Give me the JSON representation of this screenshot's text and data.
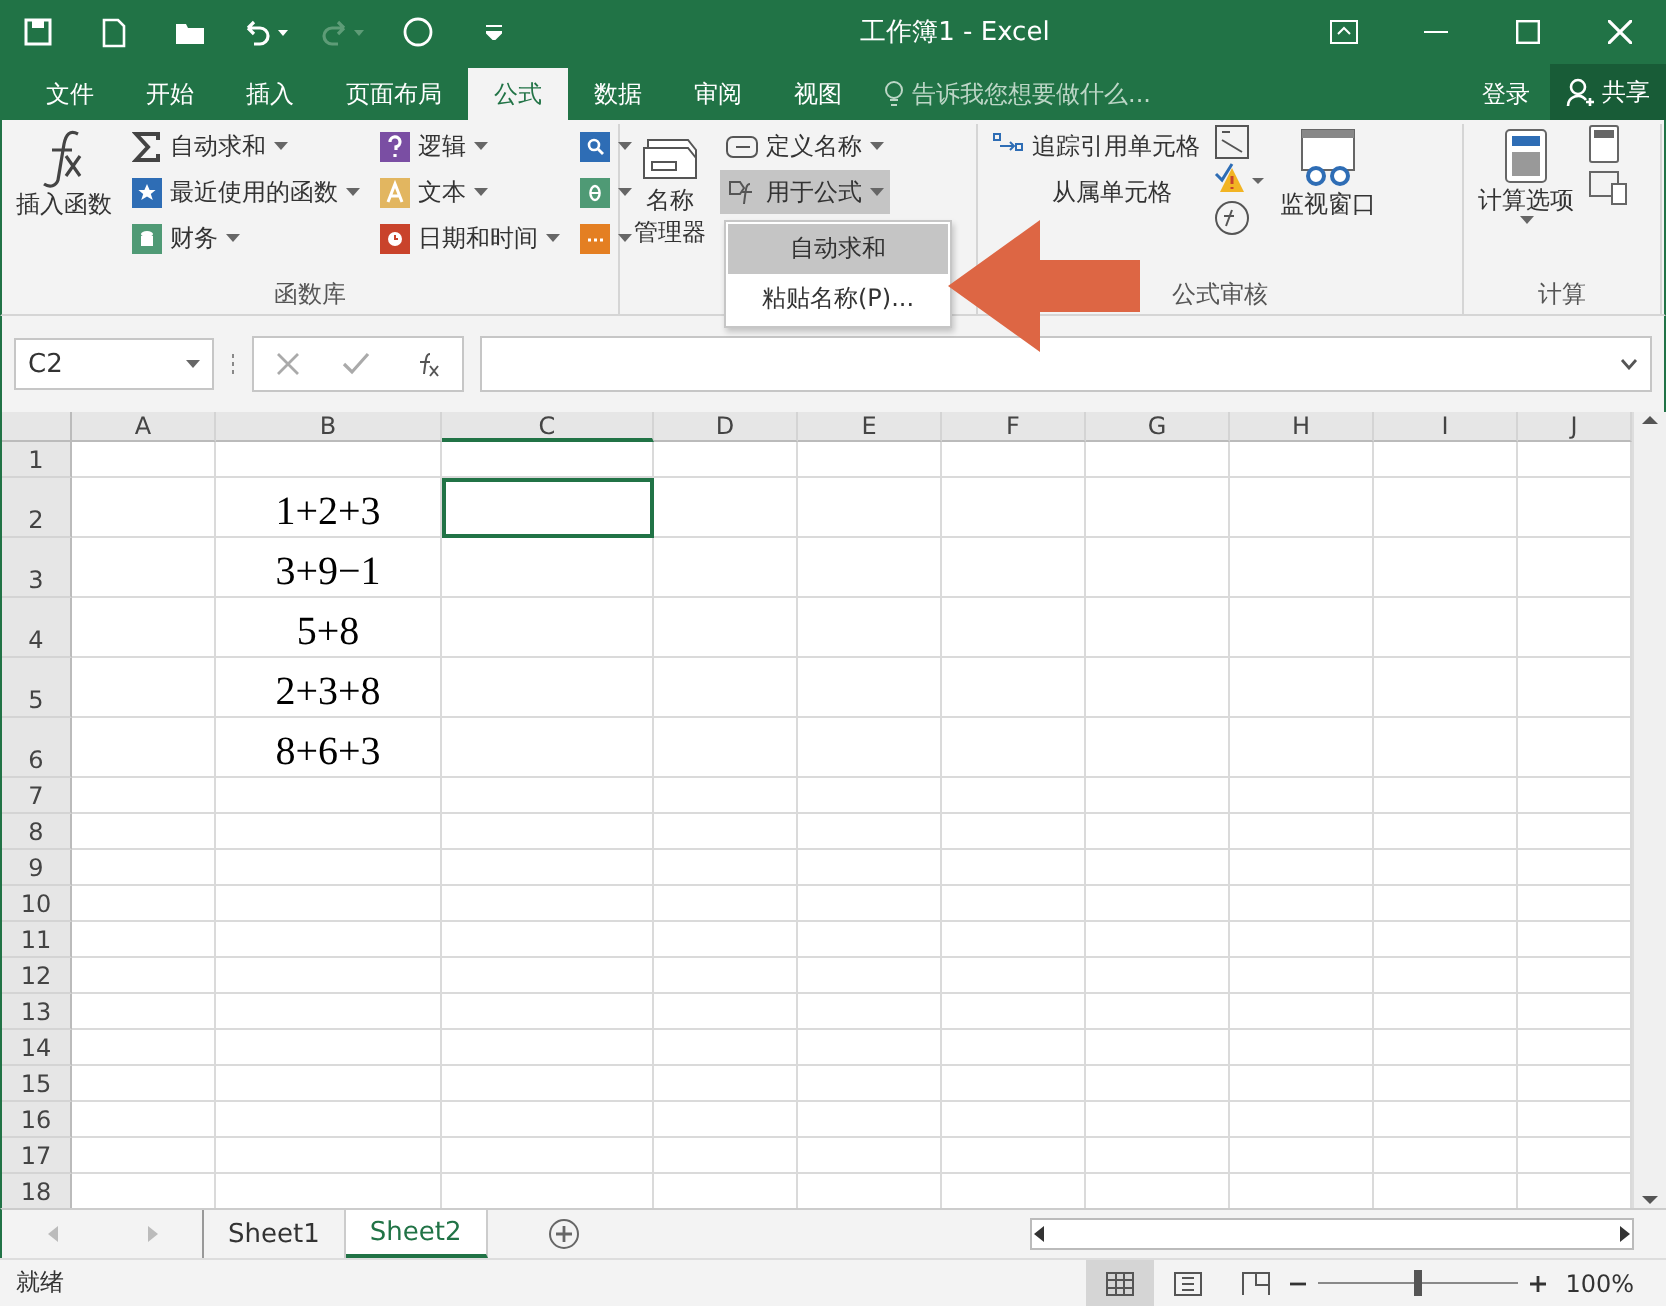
{
  "window": {
    "title": "工作簿1 - Excel"
  },
  "ribbon_tabs": [
    {
      "label": "文件",
      "selected": false
    },
    {
      "label": "开始",
      "selected": false
    },
    {
      "label": "插入",
      "selected": false
    },
    {
      "label": "页面布局",
      "selected": false
    },
    {
      "label": "公式",
      "selected": true
    },
    {
      "label": "数据",
      "selected": false
    },
    {
      "label": "审阅",
      "selected": false
    },
    {
      "label": "视图",
      "selected": false
    }
  ],
  "tell_me": {
    "placeholder": "告诉我您想要做什么..."
  },
  "sign_in": "登录",
  "share": "共享",
  "function_library": {
    "label": "函数库",
    "insert_function": "插入函数",
    "items": [
      "自动求和",
      "最近使用的函数",
      "财务",
      "逻辑",
      "文本",
      "日期和时间"
    ]
  },
  "defined_names": {
    "name_manager": [
      "名称",
      "管理器"
    ],
    "define_name": "定义名称",
    "use_in_formula": {
      "label": "用于公式",
      "expanded": true
    },
    "menu": [
      {
        "label": "自动求和",
        "selected": true
      },
      {
        "label": "粘贴名称(P)...",
        "selected": false
      }
    ]
  },
  "formula_auditing": {
    "label": "公式审核",
    "trace_precedents": "追踪引用单元格",
    "trace_dependents": "从属单元格",
    "watch_window": "监视窗口"
  },
  "calculation": {
    "label": "计算",
    "options": "计算选项"
  },
  "name_box": "C2",
  "columns": [
    "A",
    "B",
    "C",
    "D",
    "E",
    "F",
    "G",
    "H",
    "I",
    "J"
  ],
  "rows": [
    {
      "header": "1",
      "c_selected": false
    },
    {
      "header": "2",
      "B": "1+2+3",
      "c_selected": true
    },
    {
      "header": "3",
      "B": "3+9−1",
      "c_selected": false
    },
    {
      "header": "4",
      "B": "5+8",
      "c_selected": false
    },
    {
      "header": "5",
      "B": "2+3+8",
      "c_selected": false
    },
    {
      "header": "6",
      "B": "8+6+3",
      "c_selected": false
    },
    {
      "header": "7",
      "c_selected": false
    },
    {
      "header": "8",
      "c_selected": false
    },
    {
      "header": "9",
      "c_selected": false
    },
    {
      "header": "10",
      "c_selected": false
    },
    {
      "header": "11",
      "c_selected": false
    },
    {
      "header": "12",
      "c_selected": false
    },
    {
      "header": "13",
      "c_selected": false
    },
    {
      "header": "14",
      "c_selected": false
    },
    {
      "header": "15",
      "c_selected": false
    },
    {
      "header": "16",
      "c_selected": false
    },
    {
      "header": "17",
      "c_selected": false
    },
    {
      "header": "18",
      "c_selected": false
    }
  ],
  "sheets": [
    {
      "label": "Sheet1",
      "selected": false
    },
    {
      "label": "Sheet2",
      "selected": true
    }
  ],
  "status_bar": {
    "text": "就绪",
    "zoom": "100%",
    "zoom_level": {
      "level": 0.5
    }
  }
}
